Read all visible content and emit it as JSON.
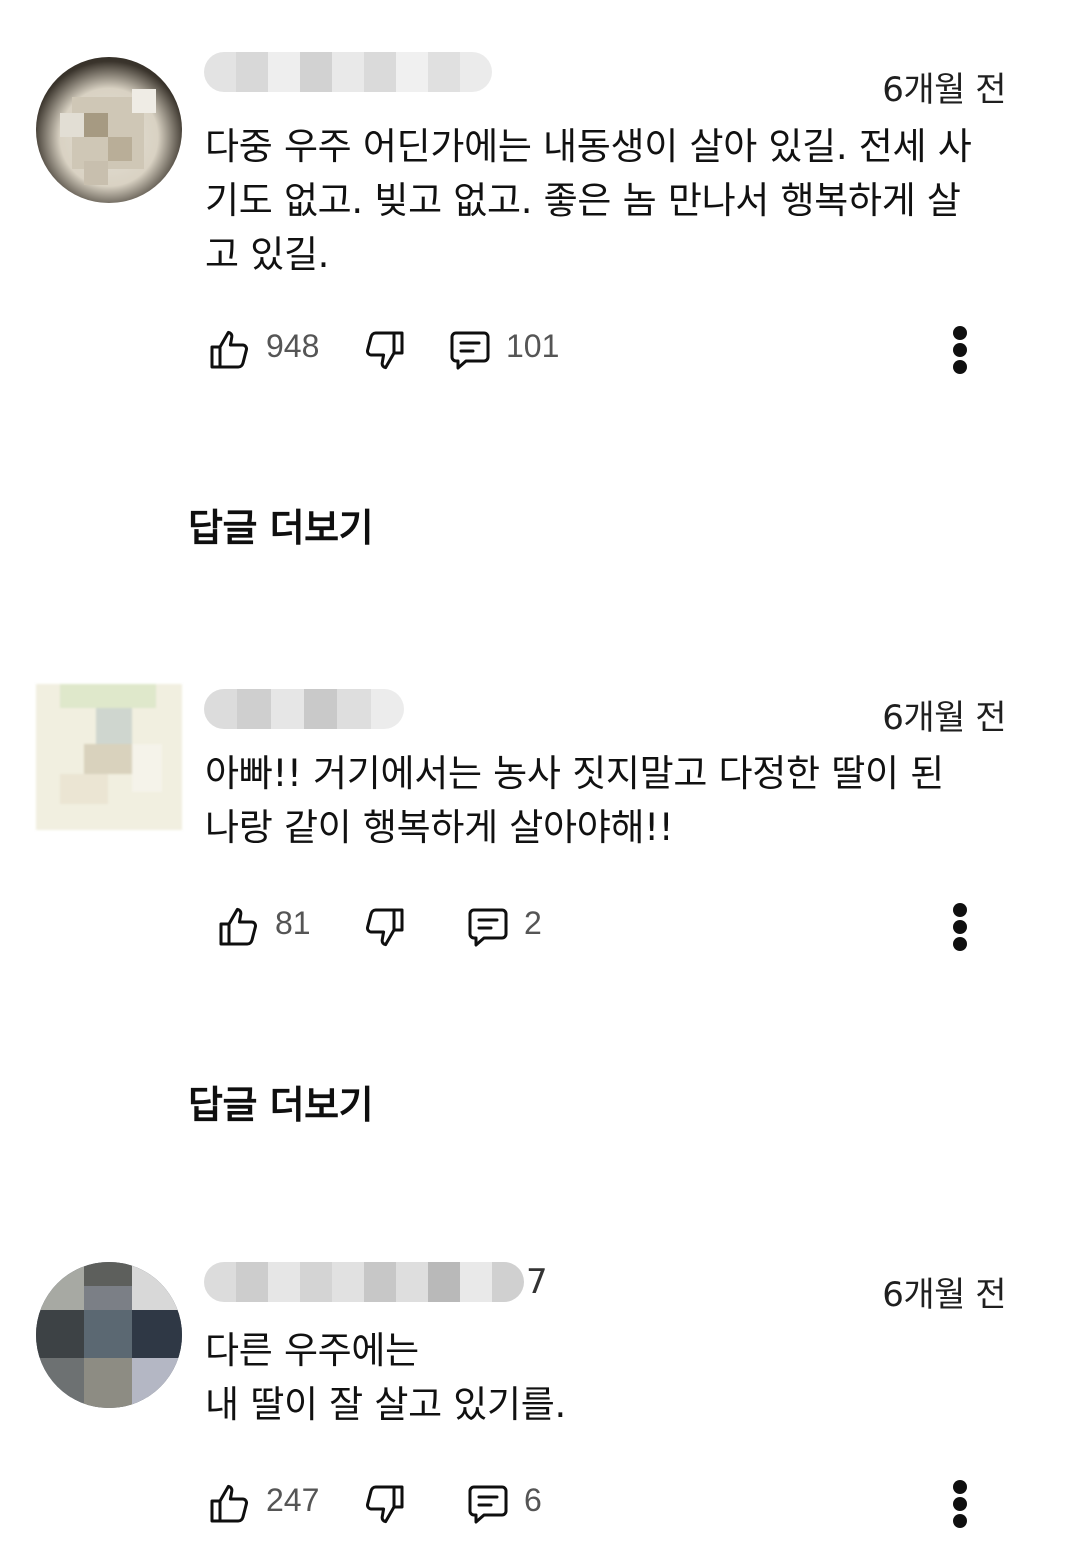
{
  "comments": [
    {
      "author": "",
      "timestamp": "6개월 전",
      "text": "다중 우주 어딘가에는 내동생이 살아 있길. 전세 사\n기도 없고. 빚고 없고. 좋은 놈 만나서 행복하게 살\n고 있길.",
      "likes": "948",
      "replies": "101",
      "view_replies_label": "답글 더보기"
    },
    {
      "author": "",
      "timestamp": "6개월 전",
      "text": "아빠!! 거기에서는 농사 짓지말고 다정한 딸이 된\n나랑 같이 행복하게 살아야해!!",
      "likes": "81",
      "replies": "2",
      "view_replies_label": "답글 더보기"
    },
    {
      "author": "",
      "author_suffix": "7",
      "timestamp": "6개월 전",
      "text": "다른 우주에는\n내 딸이 잘 살고 있기를.",
      "likes": "247",
      "replies": "6"
    }
  ],
  "icons": {
    "like": "thumbs-up-icon",
    "dislike": "thumbs-down-icon",
    "reply": "comment-icon",
    "more": "more-vertical-icon"
  }
}
